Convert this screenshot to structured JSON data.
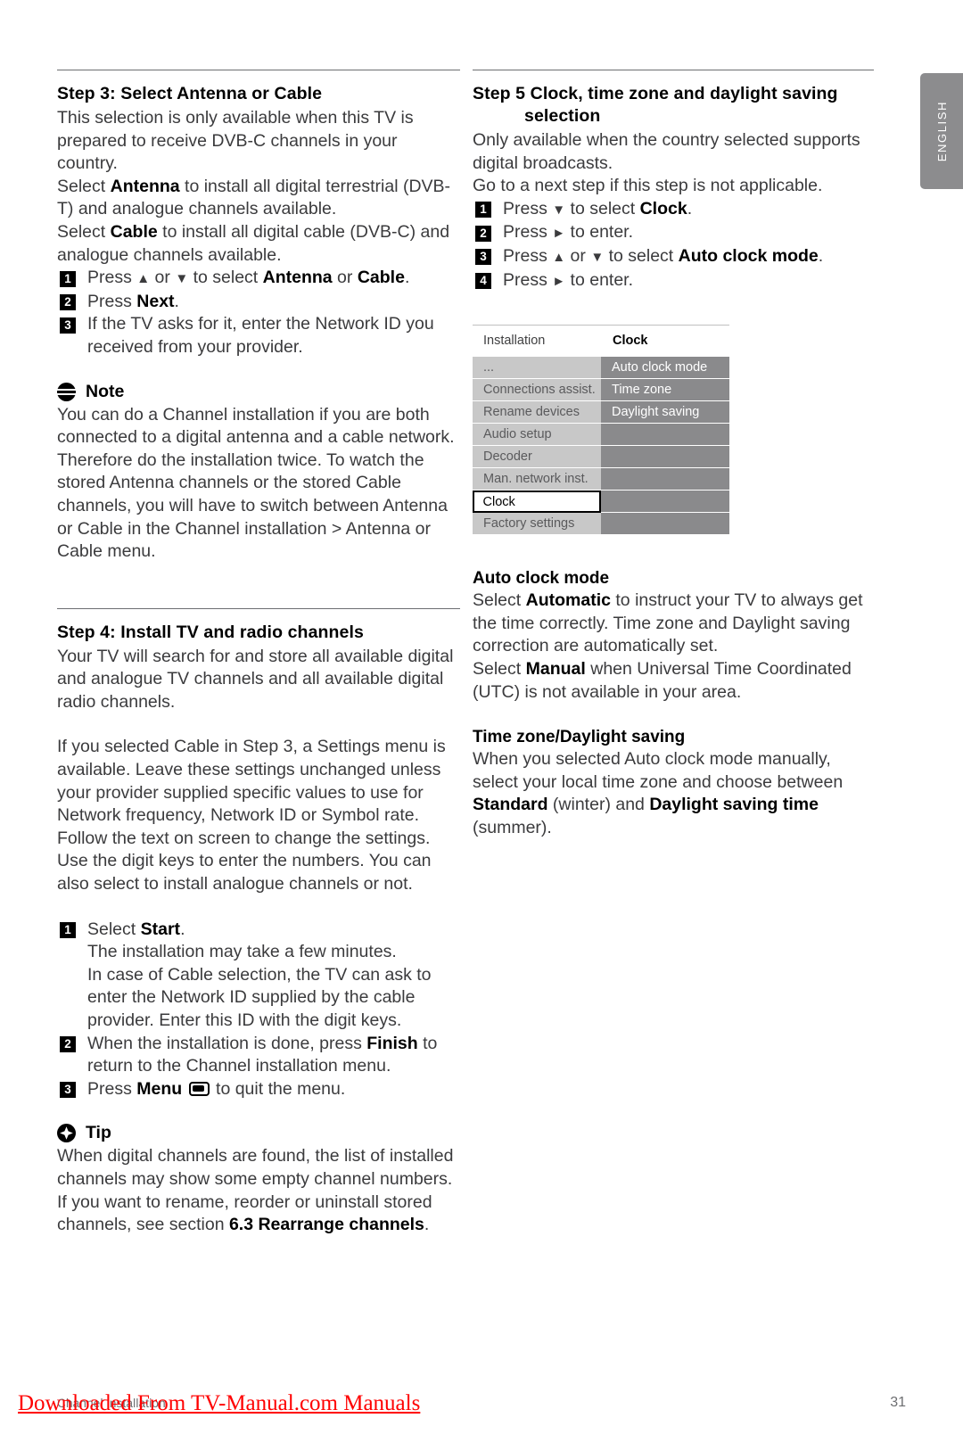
{
  "sidetab": {
    "label": "ENGLISH"
  },
  "left_column": {
    "step3": {
      "heading": "Step 3:  Select Antenna or Cable",
      "para1": "This selection is only available when this TV is prepared to receive DVB-C channels in your country.",
      "para2_pre": "Select ",
      "para2_b1": "Antenna",
      "para2_mid": " to install all digital terrestrial (DVB-T) and analogue channels available.",
      "para3_pre": "Select ",
      "para3_b1": "Cable",
      "para3_mid": " to install all digital cable (DVB-C) and analogue channels available.",
      "steps": [
        {
          "n": "1",
          "text": "Press ▲ or ▼ to select Antenna or Cable."
        },
        {
          "n": "2",
          "text": "Press Next."
        },
        {
          "n": "3",
          "text": "If the TV asks for it, enter the Network ID you received from your provider."
        }
      ]
    },
    "note": {
      "icon": "note-icon",
      "title": "Note",
      "body": "You can do a Channel installation if you are both connected to a digital antenna and a cable network. Therefore do the installation twice. To watch the stored Antenna channels or the stored Cable channels, you will have to switch between Antenna or Cable in the Channel installation > Antenna or Cable menu."
    },
    "step4": {
      "heading": "Step 4: Install TV and radio channels",
      "para1": "Your TV will search for and store all available digital and analogue TV channels and all available digital radio channels.",
      "para2": "If you selected Cable in Step 3, a Settings menu is available. Leave these settings unchanged unless your provider supplied specific values to use for Network frequency, Network ID or Symbol rate. Follow the text on screen to change the settings. Use the digit keys to enter the numbers. You can also select to install analogue channels or not.",
      "steps": [
        {
          "n": "1",
          "text": "Select Start.\nThe installation may take a few minutes.\nIn case of Cable selection, the TV can ask to enter the Network ID supplied by the cable provider. Enter this ID with the digit keys."
        },
        {
          "n": "2",
          "text": "When the installation is done, press Finish to return to the Channel installation menu."
        },
        {
          "n": "3",
          "text": "Press Menu ▣ to quit the menu."
        }
      ]
    },
    "tip": {
      "icon": "tip-icon",
      "title": "Tip",
      "body_pre": "When digital channels are found, the list of installed channels may show some empty channel numbers. If you want to rename, reorder or uninstall stored channels, see section ",
      "body_bold": "6.3 Rearrange channels",
      "body_post": "."
    }
  },
  "right_column": {
    "step5": {
      "heading_line1": "Step 5  Clock, time zone and daylight saving",
      "heading_line2": "selection",
      "para1": "Only available when the country selected supports digital broadcasts.",
      "para2": "Go to a next step if this step is not applicable.",
      "steps": [
        {
          "n": "1",
          "text": "Press ▼ to select Clock."
        },
        {
          "n": "2",
          "text": "Press ► to enter."
        },
        {
          "n": "3",
          "text": "Press ▲ or ▼ to select Auto clock mode."
        },
        {
          "n": "4",
          "text": "Press ► to enter."
        }
      ]
    },
    "tv_menu": {
      "header_left": "Installation",
      "header_right": "Clock",
      "rows": [
        {
          "left": "...",
          "right": "Auto clock mode",
          "right_on": true,
          "selected": false
        },
        {
          "left": "Connections assist.",
          "right": "Time zone",
          "right_on": true,
          "selected": false
        },
        {
          "left": "Rename devices",
          "right": "Daylight saving",
          "right_on": true,
          "selected": false
        },
        {
          "left": "Audio setup",
          "right": "",
          "right_on": false,
          "selected": false
        },
        {
          "left": "Decoder",
          "right": "",
          "right_on": false,
          "selected": false
        },
        {
          "left": "Man. network inst.",
          "right": "",
          "right_on": false,
          "selected": false
        },
        {
          "left": "Clock",
          "right": "",
          "right_on": false,
          "selected": true
        },
        {
          "left": "Factory settings",
          "right": "",
          "right_on": false,
          "selected": false
        }
      ]
    },
    "auto_clock": {
      "heading": "Auto clock mode",
      "p1_pre": "Select ",
      "p1_b": "Automatic",
      "p1_post": " to instruct your TV to always get the time correctly. Time zone and Daylight saving correction are automatically set.",
      "p2_pre": "Select ",
      "p2_b": "Manual",
      "p2_post": " when Universal Time Coordinated (UTC) is not available in your area."
    },
    "timezone": {
      "heading": "Time zone/Daylight saving",
      "p1_pre": "When you selected Auto clock mode manually, select your local time zone and choose between ",
      "p1_b1": "Standard",
      "p1_mid": " (winter) and ",
      "p1_b2": "Daylight saving time",
      "p1_post": " (summer)."
    }
  },
  "footer": {
    "section_label": "Channel installation",
    "page_number": "31",
    "watermark": "Downloaded From TV-Manual.com Manuals"
  }
}
